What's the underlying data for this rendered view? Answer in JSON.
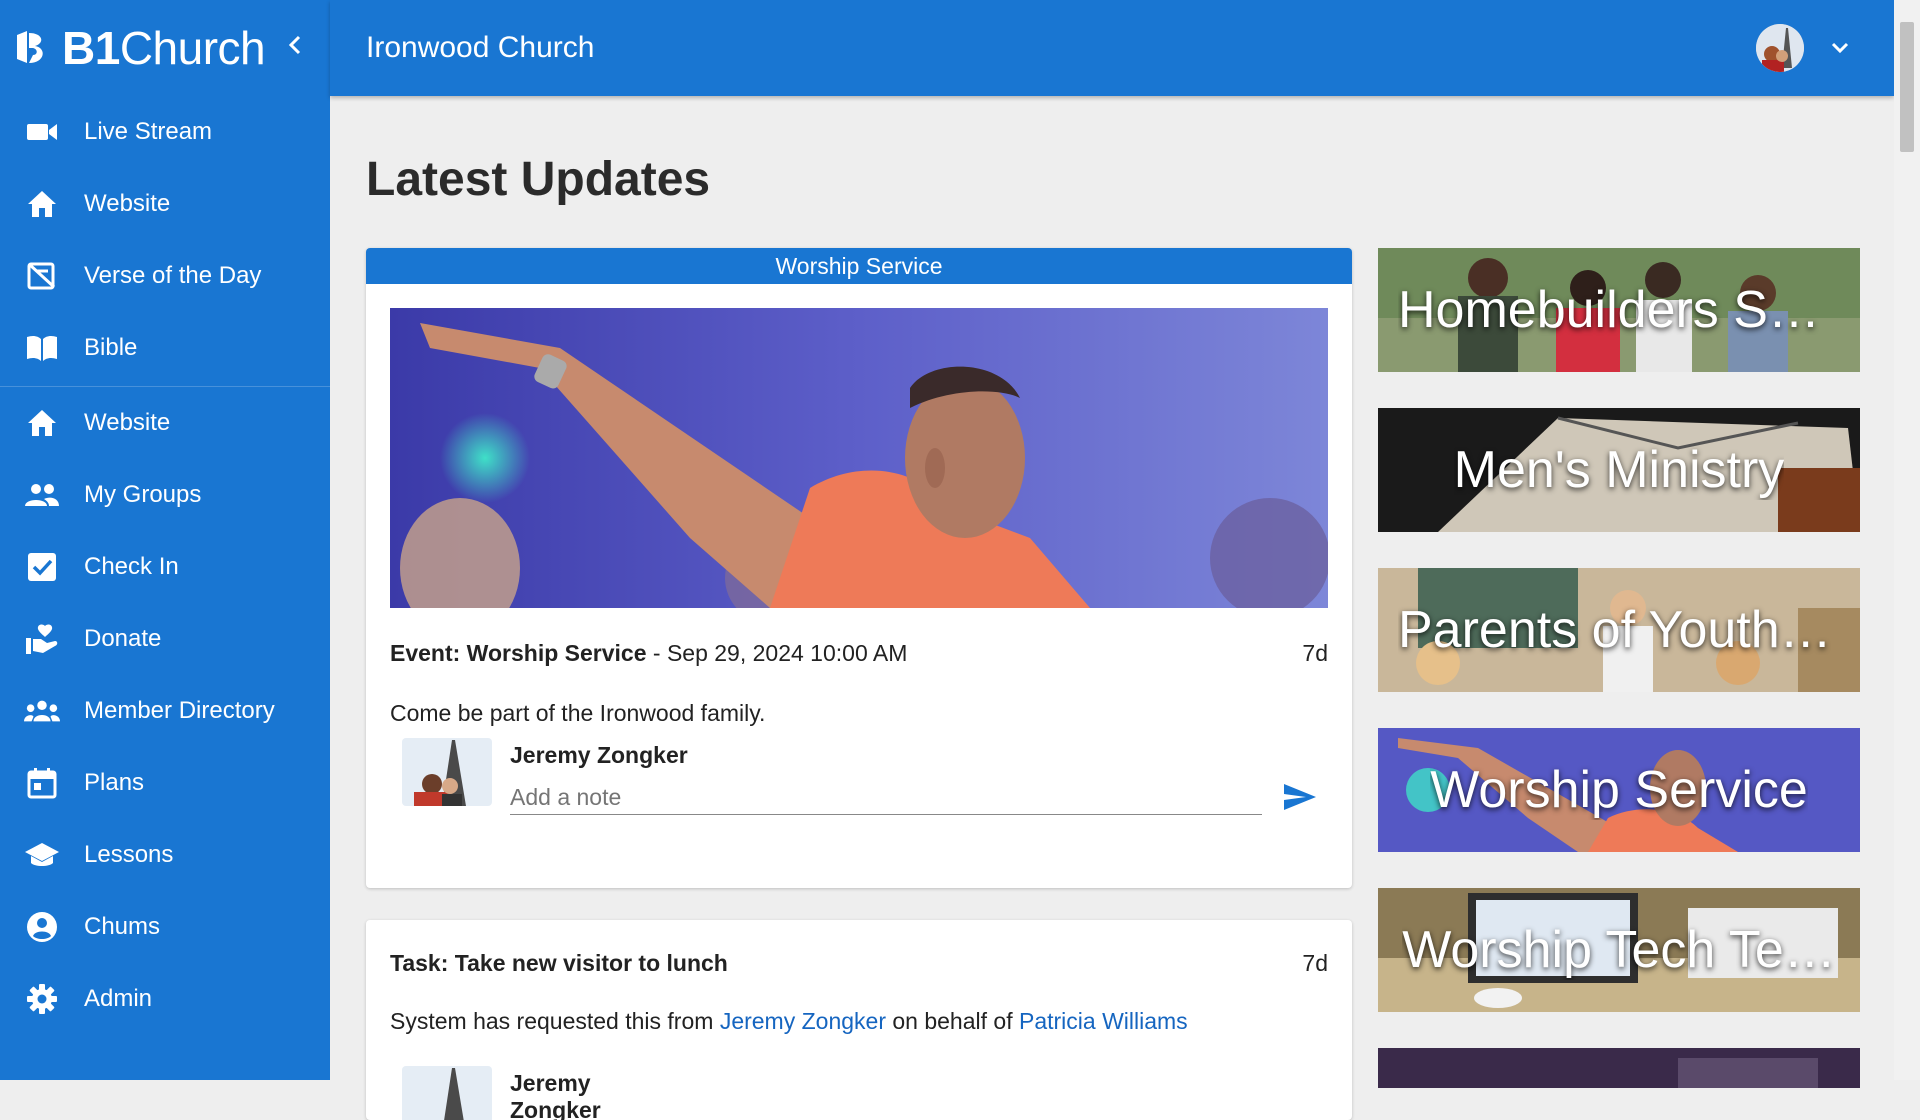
{
  "app": {
    "brand_bold": "B1",
    "brand_light": "Church",
    "church_name": "Ironwood Church"
  },
  "sidebar": {
    "primary": [
      {
        "label": "Live Stream",
        "icon": "video-camera-icon"
      },
      {
        "label": "Website",
        "icon": "home-icon"
      },
      {
        "label": "Verse of the Day",
        "icon": "verse-icon"
      },
      {
        "label": "Bible",
        "icon": "book-icon"
      }
    ],
    "secondary": [
      {
        "label": "Website",
        "icon": "home-icon"
      },
      {
        "label": "My Groups",
        "icon": "groups-icon"
      },
      {
        "label": "Check In",
        "icon": "checkbox-icon"
      },
      {
        "label": "Donate",
        "icon": "donate-icon"
      },
      {
        "label": "Member Directory",
        "icon": "directory-icon"
      },
      {
        "label": "Plans",
        "icon": "calendar-icon"
      },
      {
        "label": "Lessons",
        "icon": "school-icon"
      },
      {
        "label": "Chums",
        "icon": "account-circle-icon"
      },
      {
        "label": "Admin",
        "icon": "gear-icon"
      }
    ]
  },
  "main": {
    "title": "Latest Updates",
    "event_card": {
      "header": "Worship Service",
      "event_prefix": "Event: Worship Service",
      "event_date": " - Sep 29, 2024 10:00 AM",
      "age": "7d",
      "description": "Come be part of the Ironwood family.",
      "commenter": "Jeremy Zongker",
      "note_placeholder": "Add a note"
    },
    "task_card": {
      "title": "Task: Take new visitor to lunch",
      "age": "7d",
      "desc_prefix": "System has requested this from ",
      "requested_from": "Jeremy Zongker",
      "desc_middle": " on behalf of ",
      "on_behalf_of": "Patricia Williams",
      "commenter": "Jeremy Zongker"
    },
    "groups": [
      "Homebuilders Su…",
      "Men's Ministry",
      "Parents of Youth …",
      "Worship Service",
      "Worship Tech Te…"
    ]
  },
  "colors": {
    "primary": "#1976d2",
    "link": "#1565c0",
    "background": "#eeeeee"
  }
}
